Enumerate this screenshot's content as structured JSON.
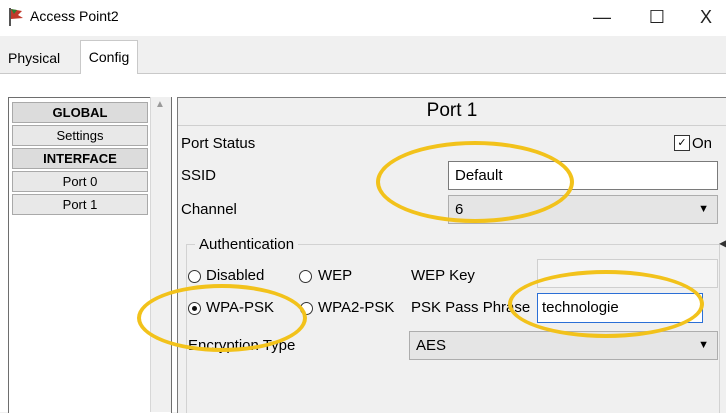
{
  "window": {
    "title": "Access Point2",
    "controls": {
      "minimize": "—",
      "maximize": "☐",
      "close": "X"
    }
  },
  "tabs": [
    {
      "label": "Physical",
      "selected": false
    },
    {
      "label": "Config",
      "selected": true
    }
  ],
  "sidebar": {
    "items": [
      {
        "label": "GLOBAL",
        "type": "header"
      },
      {
        "label": "Settings",
        "type": "item"
      },
      {
        "label": "INTERFACE",
        "type": "header"
      },
      {
        "label": "Port 0",
        "type": "item"
      },
      {
        "label": "Port 1",
        "type": "item"
      }
    ]
  },
  "port": {
    "title": "Port 1",
    "port_status_label": "Port Status",
    "on_label": "On",
    "on_checked": true,
    "ssid_label": "SSID",
    "ssid_value": "Default",
    "channel_label": "Channel",
    "channel_value": "6"
  },
  "authentication": {
    "title": "Authentication",
    "options": [
      {
        "label": "Disabled",
        "selected": false
      },
      {
        "label": "WEP",
        "selected": false
      },
      {
        "label": "WPA-PSK",
        "selected": true
      },
      {
        "label": "WPA2-PSK",
        "selected": false
      }
    ],
    "wep_key_label": "WEP Key",
    "wep_key_value": "",
    "psk_pass_label": "PSK Pass Phrase",
    "psk_pass_value": "technologie",
    "encryption_label": "Encryption Type",
    "encryption_value": "AES"
  },
  "colors": {
    "highlight_oval": "#f2c21b",
    "input_focus_border": "#2b6fd6"
  },
  "icons": {
    "app": "access-point-icon",
    "dropdown": "chevron-down-icon",
    "checkbox": "check-icon"
  }
}
